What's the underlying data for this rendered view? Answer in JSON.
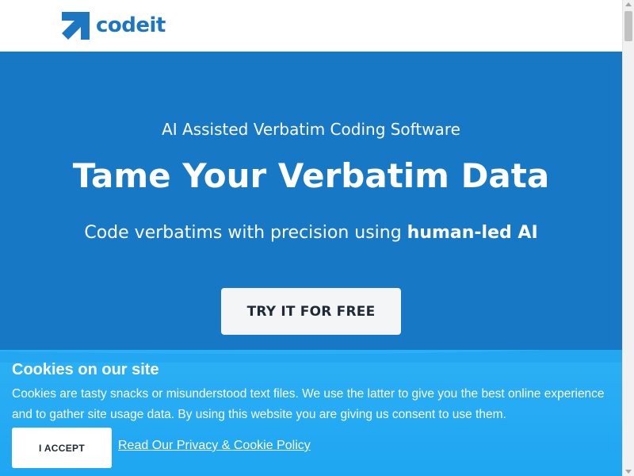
{
  "header": {
    "logo_text": "codeit"
  },
  "hero": {
    "overline": "AI Assisted Verbatim Coding Software",
    "title": "Tame Your Verbatim Data",
    "subtitle_prefix": "Code verbatims with precision using ",
    "subtitle_bold": "human-led AI",
    "cta_label": "TRY IT FOR FREE"
  },
  "cookie_banner": {
    "title": "Cookies on our site",
    "text": "Cookies are tasty snacks or misunderstood text files. We use the latter to give you the best online experience and to gather site usage data. By using this website you are giving us consent to use them.",
    "accept_label": "I ACCEPT",
    "policy_link": "Read Our Privacy & Cookie Policy"
  },
  "colors": {
    "brand_blue": "#1d76c2",
    "hero_bg": "#1778c6",
    "cookie_bg": "#2cb0f5"
  }
}
